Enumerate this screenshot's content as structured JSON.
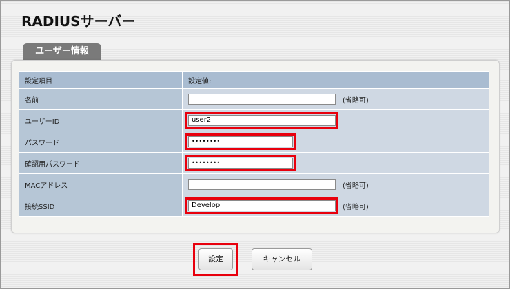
{
  "page": {
    "title": "RADIUSサーバー"
  },
  "tab": {
    "label": "ユーザー情報"
  },
  "table": {
    "header": {
      "item": "設定項目",
      "value": "設定値:"
    },
    "rows": [
      {
        "label": "名前",
        "value": "",
        "optional": "(省略可)"
      },
      {
        "label": "ユーザーID",
        "value": "user2"
      },
      {
        "label": "パスワード",
        "value": "••••••••"
      },
      {
        "label": "確認用パスワード",
        "value": "••••••••"
      },
      {
        "label": "MACアドレス",
        "value": "",
        "optional": "(省略可)"
      },
      {
        "label": "接続SSID",
        "value": "Develop",
        "optional": "(省略可)"
      }
    ]
  },
  "buttons": {
    "save": "設定",
    "cancel": "キャンセル"
  },
  "colors": {
    "highlight": "#e8000d",
    "header_row": "#a9bcd1",
    "label_cell": "#b6c6d6",
    "value_cell": "#cfd8e3"
  }
}
